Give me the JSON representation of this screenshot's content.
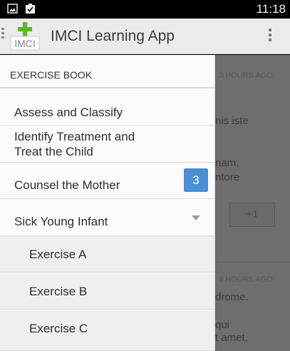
{
  "status_bar": {
    "time": "11:18",
    "icons": [
      "image-icon",
      "clipboard-check-icon"
    ]
  },
  "app_bar": {
    "title": "IMCI Learning App",
    "logo_text": "IMCI",
    "logo_accent": "#5fb52a",
    "overflow_icon": "more-vert-icon"
  },
  "background_content": {
    "timestamp_1": "3 HOURS AGO",
    "line_1": "nis iste",
    "line_2": "nam,",
    "line_3": "ntore",
    "plus_button": "+1",
    "timestamp_2": "6 HOURS AGO",
    "line_4": "drome.",
    "line_5": "qui",
    "line_6": "t amet,"
  },
  "drawer": {
    "header": "EXERCISE BOOK",
    "items": [
      {
        "label": "Assess and Classify"
      },
      {
        "label": "Identify Treatment and Treat the Child"
      },
      {
        "label": "Counsel the Mother",
        "badge": "3"
      },
      {
        "label": "Sick Young Infant",
        "expanded": true
      }
    ],
    "sub_items": [
      {
        "label": "Exercise A"
      },
      {
        "label": "Exercise B"
      },
      {
        "label": "Exercise C"
      }
    ],
    "badge_color": "#4a8fd3"
  }
}
